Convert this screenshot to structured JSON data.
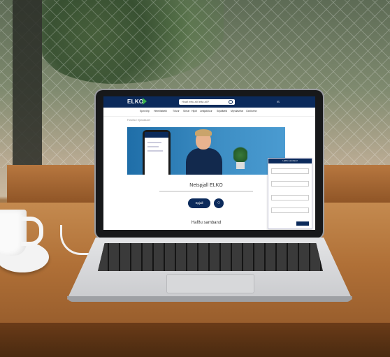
{
  "website": {
    "logo": "ELKO",
    "search_placeholder": "Hvað ertu að leita að?",
    "lang": "IS",
    "nav": [
      "Sjónvörp",
      "Heimilistæki",
      "Tölvur",
      "Símar",
      "Hljóð",
      "Leikjatölvur",
      "Snjalltæki",
      "Myndavélar",
      "Garðurinn"
    ],
    "breadcrumb": "Forsíða / Þjónustuver",
    "page_title": "Netspjall ELKO",
    "spjall_button": "Spjall",
    "section_title": "Hafðu samband",
    "panel_title": "Hafðu samband"
  },
  "colors": {
    "brand": "#0b2a5b",
    "accent": "#38b24a"
  }
}
